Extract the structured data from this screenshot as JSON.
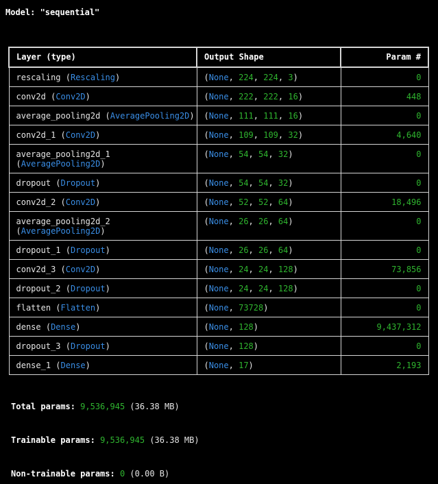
{
  "model_title": "Model: \"sequential\"",
  "table": {
    "headers": [
      "Layer (type)",
      "Output Shape",
      "Param #"
    ],
    "rows": [
      {
        "name": "rescaling",
        "type": "Rescaling",
        "shape": [
          "None",
          "224",
          "224",
          "3"
        ],
        "params": "0"
      },
      {
        "name": "conv2d",
        "type": "Conv2D",
        "shape": [
          "None",
          "222",
          "222",
          "16"
        ],
        "params": "448"
      },
      {
        "name": "average_pooling2d",
        "type": "AveragePooling2D",
        "shape": [
          "None",
          "111",
          "111",
          "16"
        ],
        "params": "0"
      },
      {
        "name": "conv2d_1",
        "type": "Conv2D",
        "shape": [
          "None",
          "109",
          "109",
          "32"
        ],
        "params": "4,640"
      },
      {
        "name": "average_pooling2d_1",
        "type": "AveragePooling2D",
        "shape": [
          "None",
          "54",
          "54",
          "32"
        ],
        "params": "0",
        "wrap": true
      },
      {
        "name": "dropout",
        "type": "Dropout",
        "shape": [
          "None",
          "54",
          "54",
          "32"
        ],
        "params": "0"
      },
      {
        "name": "conv2d_2",
        "type": "Conv2D",
        "shape": [
          "None",
          "52",
          "52",
          "64"
        ],
        "params": "18,496"
      },
      {
        "name": "average_pooling2d_2",
        "type": "AveragePooling2D",
        "shape": [
          "None",
          "26",
          "26",
          "64"
        ],
        "params": "0",
        "wrap": true
      },
      {
        "name": "dropout_1",
        "type": "Dropout",
        "shape": [
          "None",
          "26",
          "26",
          "64"
        ],
        "params": "0"
      },
      {
        "name": "conv2d_3",
        "type": "Conv2D",
        "shape": [
          "None",
          "24",
          "24",
          "128"
        ],
        "params": "73,856"
      },
      {
        "name": "dropout_2",
        "type": "Dropout",
        "shape": [
          "None",
          "24",
          "24",
          "128"
        ],
        "params": "0"
      },
      {
        "name": "flatten",
        "type": "Flatten",
        "shape": [
          "None",
          "73728"
        ],
        "params": "0"
      },
      {
        "name": "dense",
        "type": "Dense",
        "shape": [
          "None",
          "128"
        ],
        "params": "9,437,312"
      },
      {
        "name": "dropout_3",
        "type": "Dropout",
        "shape": [
          "None",
          "128"
        ],
        "params": "0"
      },
      {
        "name": "dense_1",
        "type": "Dense",
        "shape": [
          "None",
          "17"
        ],
        "params": "2,193"
      }
    ]
  },
  "totals": {
    "total": {
      "label": "Total params:",
      "value": "9,536,945",
      "size": "(36.38 MB)"
    },
    "trainable": {
      "label": "Trainable params:",
      "value": "9,536,945",
      "size": "(36.38 MB)"
    },
    "non_trainable": {
      "label": "Non-trainable params:",
      "value": "0",
      "size": "(0.00 B)"
    }
  },
  "colors": {
    "background": "#000000",
    "text": "#e6e6e6",
    "class_name": "#3a8ee6",
    "number": "#2fb52f",
    "border": "#d6d6d6"
  }
}
